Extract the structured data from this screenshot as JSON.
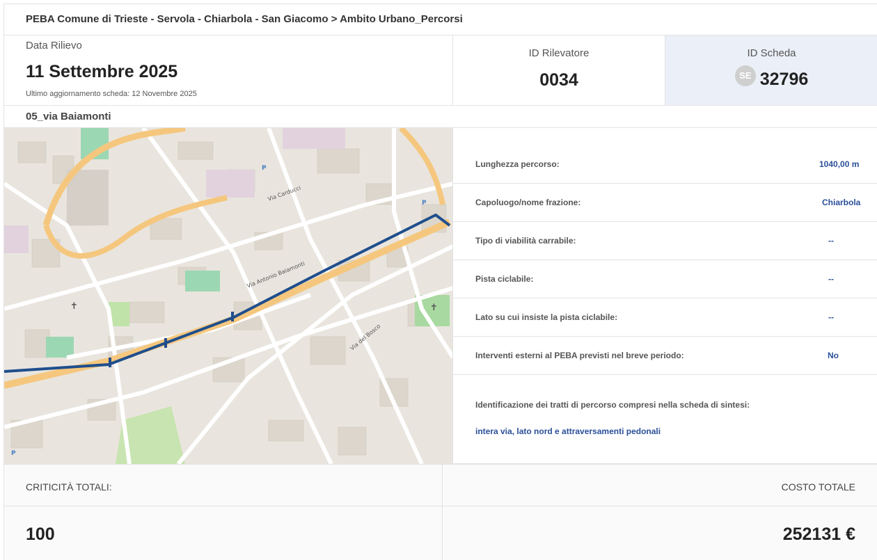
{
  "header": {
    "breadcrumb": "PEBA Comune di Trieste - Servola - Chiarbola - San Giacomo > Ambito Urbano_Percorsi"
  },
  "survey": {
    "date_label": "Data Rilievo",
    "date_value": "11 Settembre 2025",
    "last_update": "Ultimo aggiornamento scheda: 12 Novembre 2025",
    "surveyor_label": "ID Rilevatore",
    "surveyor_value": "0034",
    "sheet_label": "ID Scheda",
    "sheet_badge": "SE",
    "sheet_value": "32796"
  },
  "route": {
    "name": "05_via Baiamonti"
  },
  "map": {
    "labels": [
      "Via Antonio Baiamonti",
      "Via Carducci",
      "Via del Bosco"
    ],
    "route_color": "#1f4e8c",
    "main_road_color": "#f5c77e"
  },
  "details": [
    {
      "key": "Lunghezza percorso:",
      "value": "1040,00 m"
    },
    {
      "key": "Capoluogo/nome frazione:",
      "value": "Chiarbola"
    },
    {
      "key": "Tipo di viabilità carrabile:",
      "value": "--"
    },
    {
      "key": "Pista ciclabile:",
      "value": "--"
    },
    {
      "key": "Lato su cui insiste la pista ciclabile:",
      "value": "--"
    },
    {
      "key": "Interventi esterni al PEBA previsti nel breve periodo:",
      "value": "No"
    }
  ],
  "segments": {
    "label": "Identificazione dei tratti di percorso compresi nella scheda di sintesi:",
    "value": "intera via, lato nord e attraversamenti pedonali"
  },
  "totals": {
    "criticita_label": "CRITICITÀ TOTALI:",
    "criticita_value": "100",
    "costo_label": "COSTO TOTALE",
    "costo_value": "252131 €"
  }
}
